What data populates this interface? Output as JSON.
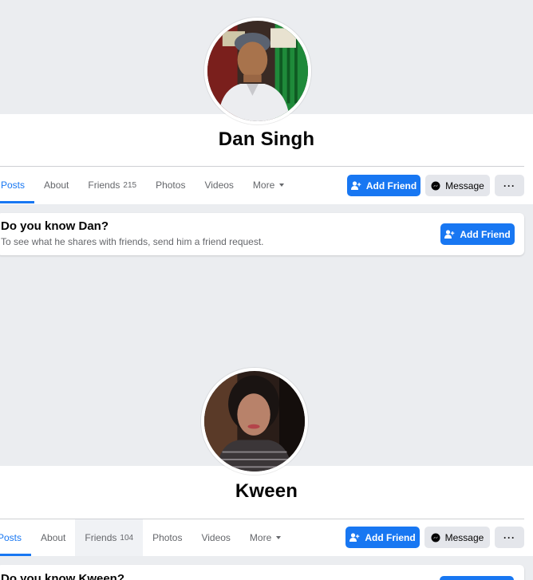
{
  "profiles": [
    {
      "name": "Dan Singh",
      "tabs": {
        "posts": "Posts",
        "about": "About",
        "friends": "Friends",
        "friends_count": "215",
        "photos": "Photos",
        "videos": "Videos",
        "more": "More"
      },
      "actions": {
        "add_friend": "Add Friend",
        "message": "Message",
        "more": "···"
      },
      "prompt": {
        "title": "Do you know Dan?",
        "subtitle": "To see what he shares with friends, send him a friend request.",
        "button": "Add Friend"
      }
    },
    {
      "name": "Kween",
      "tabs": {
        "posts": "Posts",
        "about": "About",
        "friends": "Friends",
        "friends_count": "104",
        "photos": "Photos",
        "videos": "Videos",
        "more": "More"
      },
      "actions": {
        "add_friend": "Add Friend",
        "message": "Message",
        "more": "···"
      },
      "prompt": {
        "title": "Do you know Kween?"
      }
    }
  ],
  "colors": {
    "accent": "#1877f2",
    "page_bg": "#ebedf0",
    "secondary_button": "#e4e6eb",
    "muted_text": "#65676b"
  },
  "icons": [
    "add-friend-icon",
    "messenger-icon",
    "caret-down-icon",
    "more-dots-icon"
  ]
}
